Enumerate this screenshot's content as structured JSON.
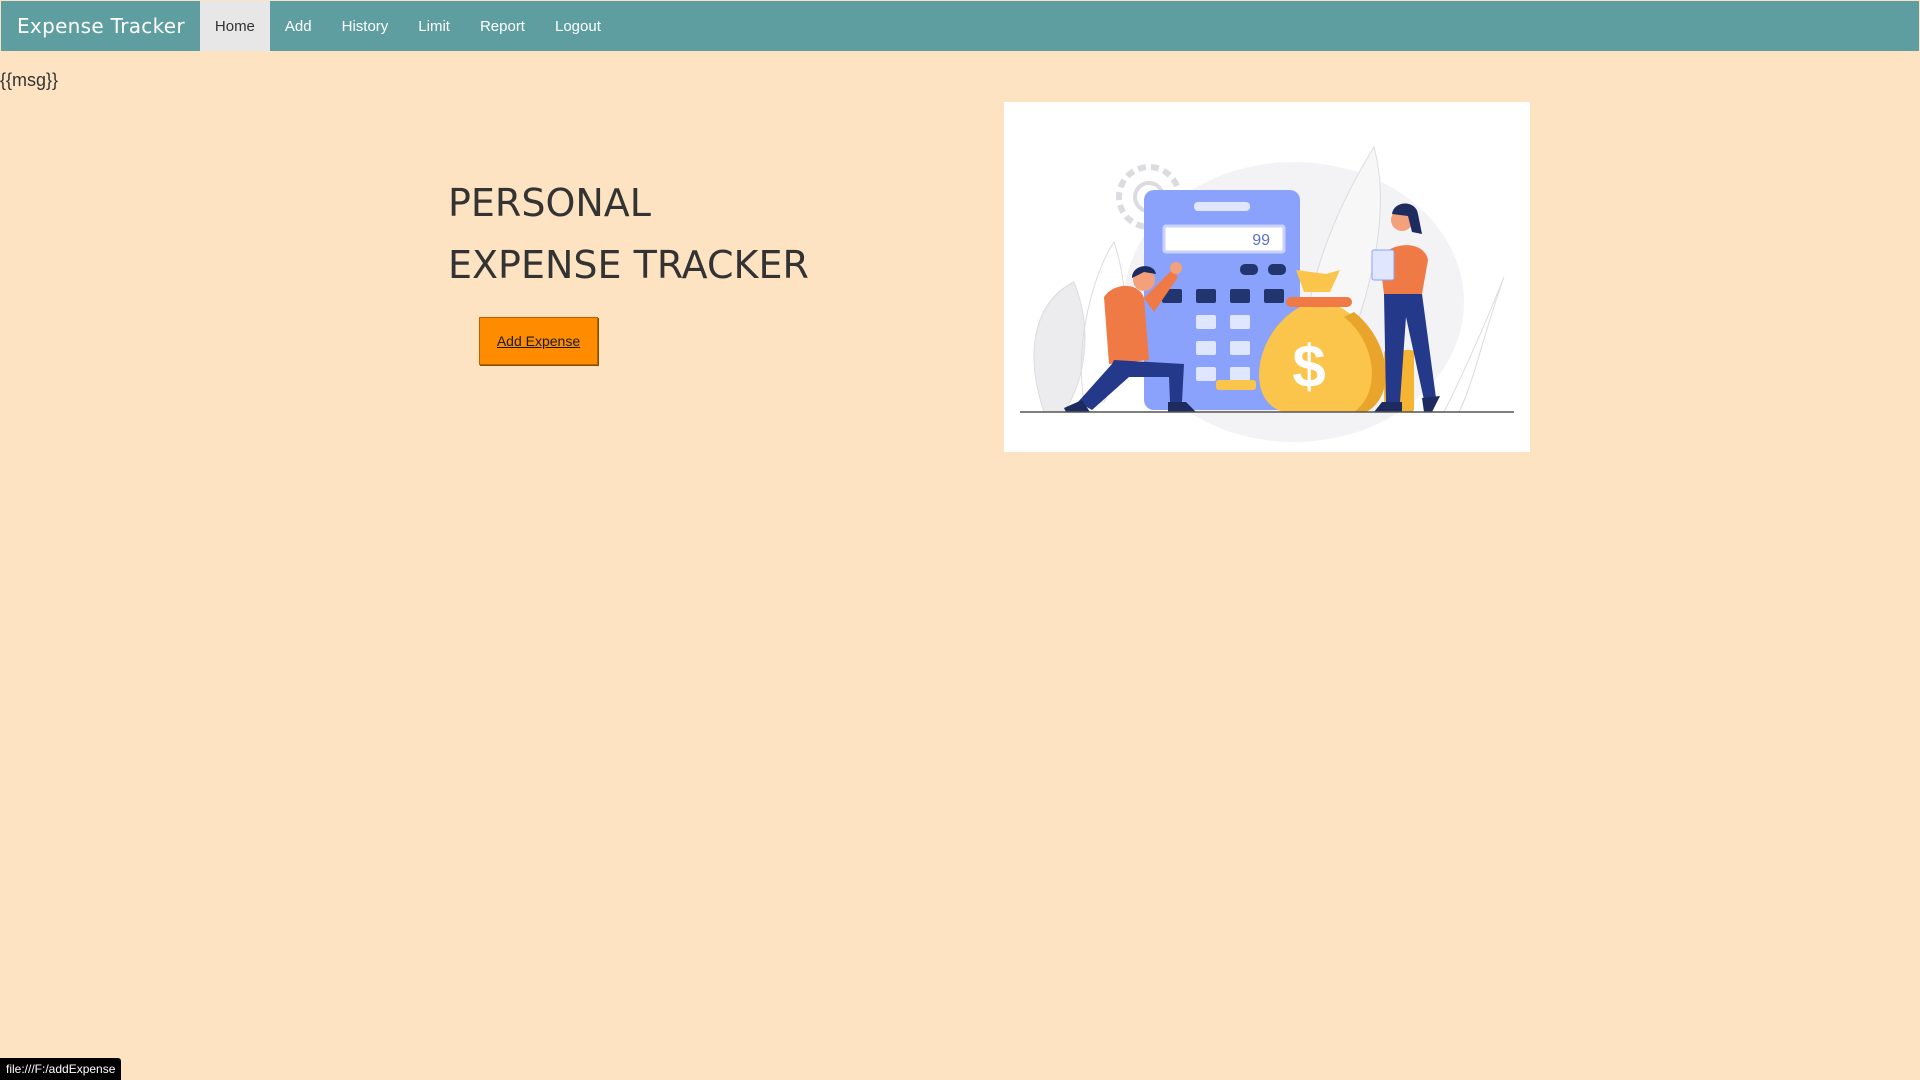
{
  "navbar": {
    "brand": "Expense Tracker",
    "links": [
      "Home",
      "Add",
      "History",
      "Limit",
      "Report",
      "Logout"
    ],
    "active_index": 0,
    "color": "#5f9ea0"
  },
  "msg": "{{msg}}",
  "hero": {
    "line1": "PERSONAL",
    "line2": "EXPENSE TRACKER",
    "button_label": "Add Expense",
    "button_color": "#ff8c00"
  },
  "illustration": {
    "calculator_display": "99",
    "money_symbol": "$"
  },
  "status_bar": "file:///F:/addExpense",
  "colors": {
    "background": "#fde3c2",
    "accent_orange": "#ef7a45",
    "accent_blue": "#8aa2fb",
    "bag_yellow": "#fbc44a"
  }
}
